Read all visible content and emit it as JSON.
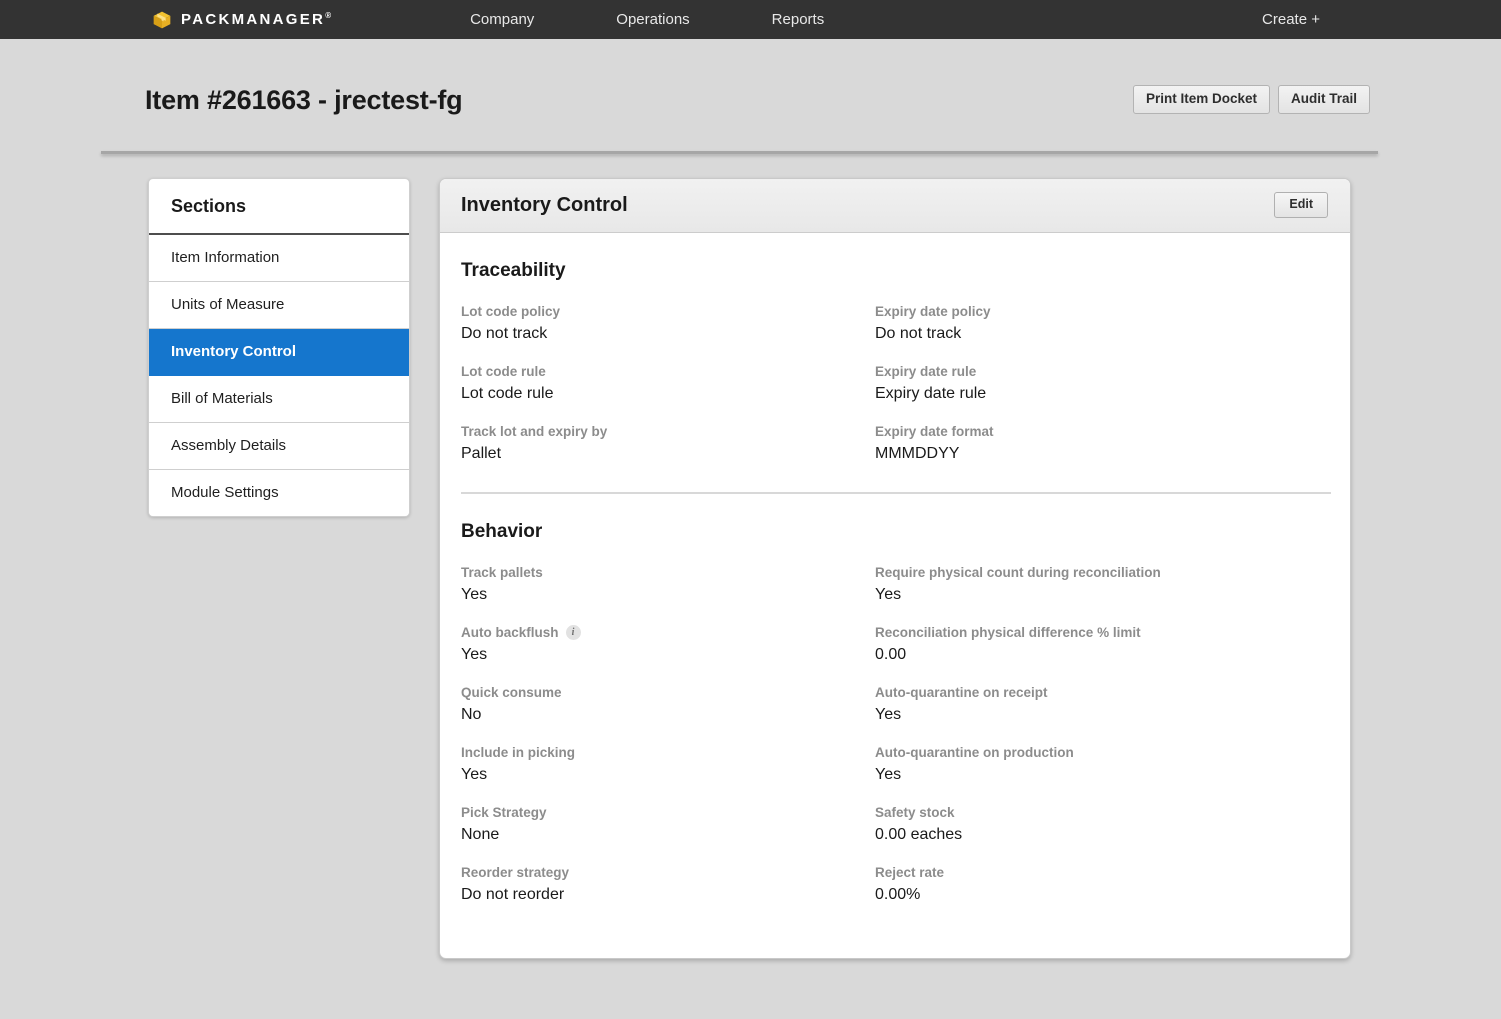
{
  "navbar": {
    "brand": "PACKMANAGER",
    "brand_trademark": "®",
    "brand_icon": "package-box-icon",
    "links": [
      {
        "label": "Company"
      },
      {
        "label": "Operations"
      },
      {
        "label": "Reports"
      }
    ],
    "create_label": "Create +",
    "background": "#333333"
  },
  "page": {
    "title": "Item #261663 - jrectest-fg",
    "actions": [
      {
        "label": "Print Item Docket",
        "name": "print-item-docket-button"
      },
      {
        "label": "Audit Trail",
        "name": "audit-trail-button"
      }
    ]
  },
  "sidebar": {
    "title": "Sections",
    "active_color": "#1576cd",
    "items": [
      {
        "label": "Item Information",
        "active": false
      },
      {
        "label": "Units of Measure",
        "active": false
      },
      {
        "label": "Inventory Control",
        "active": true
      },
      {
        "label": "Bill of Materials",
        "active": false
      },
      {
        "label": "Assembly Details",
        "active": false
      },
      {
        "label": "Module Settings",
        "active": false
      }
    ]
  },
  "panel": {
    "title": "Inventory Control",
    "edit_label": "Edit",
    "groups": [
      {
        "title": "Traceability",
        "fields": [
          {
            "label": "Lot code policy",
            "value": "Do not track",
            "info": false
          },
          {
            "label": "Expiry date policy",
            "value": "Do not track",
            "info": false
          },
          {
            "label": "Lot code rule",
            "value": "Lot code rule",
            "info": false
          },
          {
            "label": "Expiry date rule",
            "value": "Expiry date rule",
            "info": false
          },
          {
            "label": "Track lot and expiry by",
            "value": "Pallet",
            "info": false
          },
          {
            "label": "Expiry date format",
            "value": "MMMDDYY",
            "info": false
          }
        ]
      },
      {
        "title": "Behavior",
        "fields": [
          {
            "label": "Track pallets",
            "value": "Yes",
            "info": false
          },
          {
            "label": "Require physical count during reconciliation",
            "value": "Yes",
            "info": false
          },
          {
            "label": "Auto backflush",
            "value": "Yes",
            "info": true
          },
          {
            "label": "Reconciliation physical difference % limit",
            "value": "0.00",
            "info": false
          },
          {
            "label": "Quick consume",
            "value": "No",
            "info": false
          },
          {
            "label": "Auto-quarantine on receipt",
            "value": "Yes",
            "info": false
          },
          {
            "label": "Include in picking",
            "value": "Yes",
            "info": false
          },
          {
            "label": "Auto-quarantine on production",
            "value": "Yes",
            "info": false
          },
          {
            "label": "Pick Strategy",
            "value": "None",
            "info": false
          },
          {
            "label": "Safety stock",
            "value": "0.00 eaches",
            "info": false
          },
          {
            "label": "Reorder strategy",
            "value": "Do not reorder",
            "info": false
          },
          {
            "label": "Reject rate",
            "value": "0.00%",
            "info": false
          }
        ]
      }
    ]
  },
  "icons": {
    "info": "i"
  }
}
